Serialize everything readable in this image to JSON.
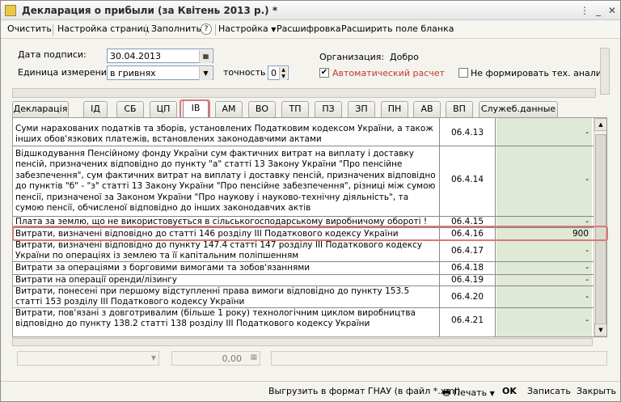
{
  "window": {
    "title": "Декларация о прибыли (за Квітень 2013 р.) *"
  },
  "toolbar": {
    "clear": "Очистить",
    "page_setup": "Настройка страниц",
    "fill": "Заполнить",
    "help": "?",
    "settings": "Настройка",
    "decode": "Расшифровка",
    "expand": "Расширить поле бланка"
  },
  "form": {
    "sign_date_label": "Дата подписи:",
    "sign_date_value": "30.04.2013",
    "unit_label": "Единица измерения:",
    "unit_value": "в гривнях",
    "precision_label": "точность",
    "precision_value": "0",
    "org_label": "Организация:",
    "org_value": "Добро",
    "auto_calc_label": "Автоматический расчет",
    "auto_calc_checked": true,
    "no_tech_label": "Не формировать тех. анализ пр",
    "no_tech_checked": false
  },
  "tabs": [
    {
      "label": "Декларація",
      "active": false
    },
    {
      "label": "ІД",
      "active": false
    },
    {
      "label": "СБ",
      "active": false
    },
    {
      "label": "ЦП",
      "active": false
    },
    {
      "label": "ІВ",
      "active": true
    },
    {
      "label": "АМ",
      "active": false
    },
    {
      "label": "ВО",
      "active": false
    },
    {
      "label": "ТП",
      "active": false
    },
    {
      "label": "ПЗ",
      "active": false
    },
    {
      "label": "ЗП",
      "active": false
    },
    {
      "label": "ПН",
      "active": false
    },
    {
      "label": "АВ",
      "active": false
    },
    {
      "label": "ВП",
      "active": false
    },
    {
      "label": "Служеб.данные",
      "active": false
    }
  ],
  "table": {
    "rows": [
      {
        "text": "Суми нарахованих податків та зборів, установлених Податковим кодексом України, а також інших обов'язкових платежів, встановлених законодавчими актами",
        "code": "06.4.13",
        "value": "-"
      },
      {
        "text": "Відшкодування Пенсійному фонду України сум фактичних витрат на виплату і доставку пенсій,  призначених відповідно до пункту \"а\" статті 13 Закону України \"Про пенсійне забезпечення\", сум фактичних витрат на виплату і доставку пенсій, призначених відповідно до пунктів \"б\" - \"з\" статті 13 Закону України \"Про пенсійне забезпечення\", різниці між сумою пенсії, призначеної за Законом України \"Про наукову і науково-технічну діяльність\", та сумою пенсії, обчисленої відповідно до інших законодавчих актів",
        "code": "06.4.14",
        "value": "-"
      },
      {
        "text": "Плата за землю, що не використовується в сільськогосподарському  виробничому  обороті !",
        "code": "06.4.15",
        "value": "-"
      },
      {
        "text": "Витрати, визначені відповідно до статті 146 розділу ІІІ Податкового кодексу України",
        "code": "06.4.16",
        "value": "900"
      },
      {
        "text": "Витрати, визначені відповідно до пункту 147.4 статті 147 розділу ІІІ Податкового кодексу України по операціях із землею та її капітальним поліпшенням",
        "code": "06.4.17",
        "value": "-"
      },
      {
        "text": "Витрати за операціями з борговими вимогами та зобов'язаннями",
        "code": "06.4.18",
        "value": "-"
      },
      {
        "text": "Витрати на операції оренди/лізингу",
        "code": "06.4.19",
        "value": "-"
      },
      {
        "text": "Витрати, понесені при першому відступленні права вимоги відповідно до пункту 153.5 статті 153 розділу ІІІ Податкового кодексу України",
        "code": "06.4.20",
        "value": "-"
      },
      {
        "text": "Витрати, пов'язані з довготривалим (більше 1 року) технологічним циклом виробництва відповідно до пункту 138.2 статті 138 розділу ІІІ Податкового кодексу України",
        "code": "06.4.21",
        "value": "-"
      }
    ]
  },
  "bottom": {
    "amount": "0,00"
  },
  "footer": {
    "export": "Выгрузить в формат ГНАУ (в файл *.xml)",
    "print": "Печать",
    "ok": "OK",
    "save": "Записать",
    "close": "Закрыть"
  }
}
